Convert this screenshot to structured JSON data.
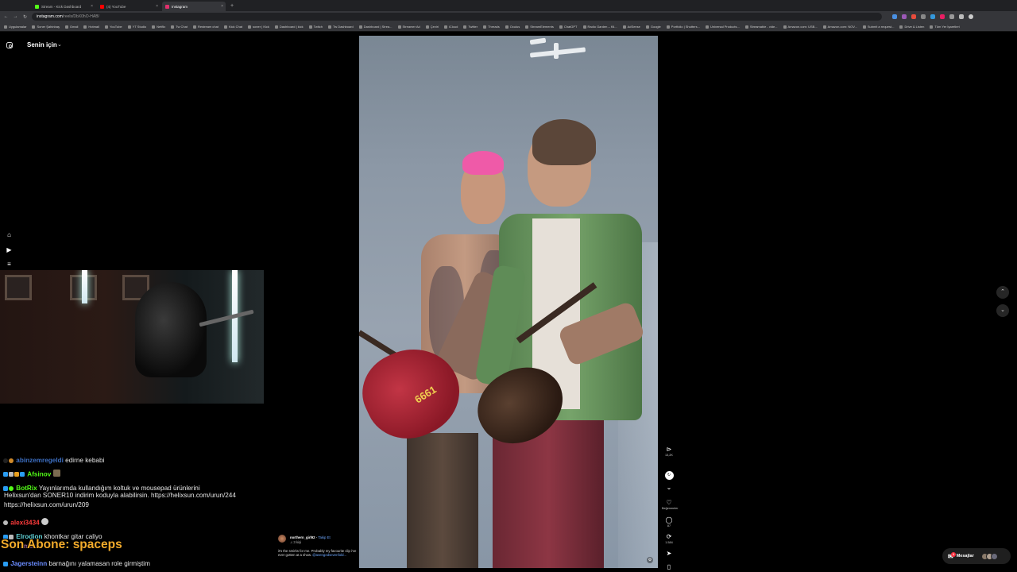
{
  "browser": {
    "tabs": [
      {
        "label": "Stream - Kick Dashboard",
        "color": "#53fc18"
      },
      {
        "label": "(4) YouTube",
        "color": "#ff0000"
      },
      {
        "label": "Instagram",
        "color": "#e1306c",
        "active": true
      }
    ],
    "new_tab": "+",
    "url_host": "instagram.com",
    "url_path": "/reels/DbX0hO-HAB/",
    "nav": {
      "back": "←",
      "forward": "→",
      "reload": "↻"
    },
    "bookmarks": [
      "Uygulamalar",
      "Soner Şahinbaş",
      "Gmail",
      "Hotmail",
      "YouTube",
      "YT Studio",
      "Netflix",
      "Tw Chat",
      "Restream chat",
      "Kick Chat",
      "soner | Kick",
      "Dashboard | kick",
      "Twitch",
      "Tw Dashboard",
      "Dashboard | Strea...",
      "Streamer Ad",
      "Çeviri",
      "iCloud",
      "Twitter",
      "Threads",
      "Oculus",
      "StreamElements",
      "ChatGPT",
      "Radio Garden – Kli...",
      "AdSense",
      "Google",
      "Portfolio | Shutters...",
      "Universal Products...",
      "Streamable - vide...",
      "Amazon.com: USB...",
      "Amazon.com: NOV...",
      "Submit a request...",
      "Drive & Listen",
      "Tüm Yer İşaretleri"
    ]
  },
  "sidebar": {
    "feed_title": "Senin için",
    "chevron": "⌄",
    "icons": [
      "instagram-icon",
      "home-icon",
      "reels-icon",
      "menu-icon"
    ]
  },
  "chat": {
    "lines": [
      {
        "user": "abinzemregeldi",
        "user_color": "#3d6fc2",
        "text": "edirne kebabi"
      },
      {
        "user": "Afsinov",
        "user_color": "#53fc18",
        "text": ""
      },
      {
        "user": "BotRix",
        "user_color": "#53fc18",
        "text": "Yayınlarımda kullandığım koltuk ve mousepad ürünlerini"
      },
      {
        "user": "alexi3434",
        "user_color": "#ff3b3b",
        "text": ""
      },
      {
        "user": "Elrodion",
        "user_color": "#5fd1d6",
        "text": "khontkar gitar caliyo"
      },
      {
        "user": "Jagersteinn",
        "user_color": "#6a8cff",
        "text": "barnağını yalamasan role girmiştim"
      }
    ],
    "botrix_continuation": "Helixsun'dan SONER10 indirim koduyla alabilirsin. https://helixsun.com/urun/244 https://helixsun.com/urun/209",
    "partial_user": "kozmos",
    "sub_overlay": "Son Abone: spaceps"
  },
  "reel": {
    "guitar_sticker": "6661",
    "caption": {
      "user": "northern_girl92",
      "follow": "Takip Et",
      "audio": "♫ 3 kişi",
      "text": "it's the smirks for me. Probably my favourite clip i've ever gotten at a show.",
      "mention": "@avengedsevenfold..."
    },
    "actions": [
      {
        "name": "mute",
        "icon": "⊳",
        "label": "13,2K"
      },
      {
        "name": "share-circle",
        "icon": "↻",
        "label": ""
      },
      {
        "name": "down",
        "icon": "⌄",
        "label": ""
      },
      {
        "name": "like",
        "icon": "♡",
        "label": "Beğenmeler"
      },
      {
        "name": "comment",
        "icon": "◯",
        "label": "87"
      },
      {
        "name": "repost",
        "icon": "⟳",
        "label": "1.584"
      },
      {
        "name": "send",
        "icon": "➤",
        "label": ""
      },
      {
        "name": "save",
        "icon": "▯",
        "label": ""
      },
      {
        "name": "more",
        "icon": "···",
        "label": ""
      }
    ]
  },
  "nav_arrows": {
    "up": "⌃",
    "down": "⌄"
  },
  "messages": {
    "label": "Mesajlar",
    "badge": "1"
  }
}
